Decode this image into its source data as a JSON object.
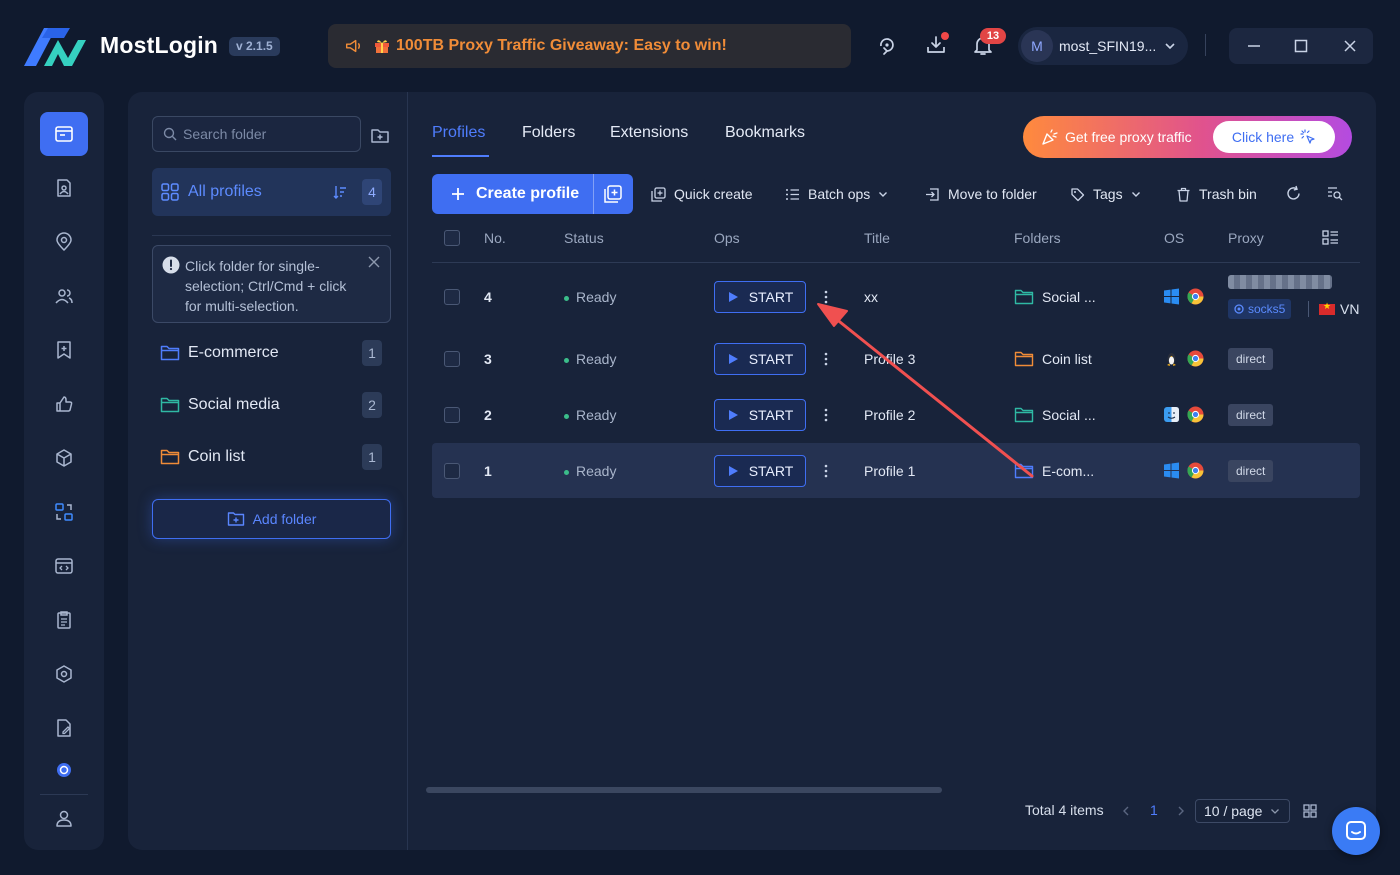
{
  "app": {
    "name": "MostLogin",
    "version": "v 2.1.5",
    "promo_text": "100TB Proxy Traffic Giveaway: Easy to win!",
    "notification_count": "13",
    "user_initial": "M",
    "username": "most_SFIN19..."
  },
  "folders_panel": {
    "search_placeholder": "Search folder",
    "all_profiles_label": "All profiles",
    "all_profiles_count": "4",
    "hint_text": "Click folder for single-selection; Ctrl/Cmd + click for multi-selection.",
    "folders": [
      {
        "name": "E-commerce",
        "count": "1",
        "color": "#4f7dfd"
      },
      {
        "name": "Social media",
        "count": "2",
        "color": "#2fb9a4"
      },
      {
        "name": "Coin list",
        "count": "1",
        "color": "#f08c38"
      }
    ],
    "add_folder_label": "Add folder"
  },
  "tabs": [
    {
      "label": "Profiles",
      "active": true
    },
    {
      "label": "Folders",
      "active": false
    },
    {
      "label": "Extensions",
      "active": false
    },
    {
      "label": "Bookmarks",
      "active": false
    }
  ],
  "proxy_banner": {
    "text": "Get free proxy traffic",
    "button": "Click here"
  },
  "toolbar": {
    "create_profile": "Create profile",
    "quick_create": "Quick create",
    "batch_ops": "Batch ops",
    "move_to_folder": "Move to folder",
    "tags": "Tags",
    "trash_bin": "Trash bin"
  },
  "table": {
    "columns": [
      "No.",
      "Status",
      "Ops",
      "Title",
      "Folders",
      "OS",
      "Proxy"
    ],
    "start_label": "START",
    "rows": [
      {
        "no": "4",
        "status": "Ready",
        "title": "xx",
        "folder": "Social ...",
        "folder_color": "#2fb9a4",
        "os": "windows",
        "proxy_type": "socks5",
        "proxy_country": "VN"
      },
      {
        "no": "3",
        "status": "Ready",
        "title": "Profile 3",
        "folder": "Coin list",
        "folder_color": "#f08c38",
        "os": "linux",
        "proxy": "direct"
      },
      {
        "no": "2",
        "status": "Ready",
        "title": "Profile 2",
        "folder": "Social ...",
        "folder_color": "#2fb9a4",
        "os": "macos",
        "proxy": "direct"
      },
      {
        "no": "1",
        "status": "Ready",
        "title": "Profile 1",
        "folder": "E-com...",
        "folder_color": "#4f7dfd",
        "os": "windows",
        "proxy": "direct"
      }
    ]
  },
  "pagination": {
    "total": "Total 4 items",
    "current_page": "1",
    "page_size": "10 / page"
  },
  "colors": {
    "accent": "#3f6ef2",
    "background": "#101a2e",
    "panel": "#18233a",
    "ready": "#3bbd8a",
    "annotation_arrow": "#f05050"
  }
}
